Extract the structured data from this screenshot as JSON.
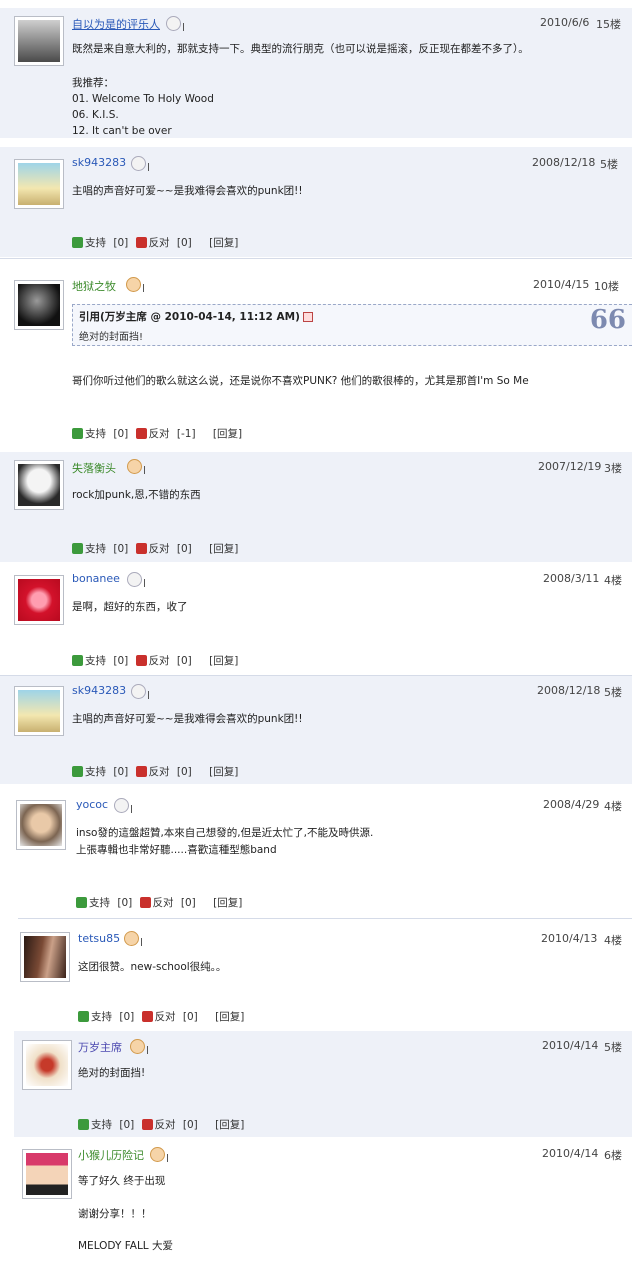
{
  "posts": [
    {
      "user": "自以为是的评乐人",
      "date": "2010/6/6",
      "floor": "15楼",
      "lines": [
        "既然是来自意大利的，那就支持一下。典型的流行朋克（也可以说是摇滚，反正现在都差不多了）。",
        "",
        "我推荐：",
        "01. Welcome To Holy Wood",
        "06. K.I.S.",
        "12. It can't be over"
      ]
    },
    {
      "user": "sk943283",
      "date": "2008/12/18",
      "floor": "5楼",
      "lines": [
        "主唱的声音好可爱~~是我难得会喜欢的punk团!!"
      ],
      "support": "[0]",
      "oppose": "[0]"
    },
    {
      "user": "地狱之牧",
      "date": "2010/4/15",
      "floor": "10楼",
      "quote_title": "引用(万岁主席 @ 2010-04-14, 11:12 AM)",
      "quote_body": "绝对的封面挡!",
      "quote_mark": "66",
      "lines": [
        "哥们你听过他们的歌么就这么说，还是说你不喜欢PUNK? 他们的歌很棒的，尤其是那首I'm So Me"
      ],
      "support": "[0]",
      "oppose": "[-1]"
    },
    {
      "user": "失落衡头",
      "date": "2007/12/19",
      "floor": "3楼",
      "lines": [
        "rock加punk,恩,不错的东西"
      ],
      "support": "[0]",
      "oppose": "[0]"
    },
    {
      "user": "bonanee",
      "date": "2008/3/11",
      "floor": "4楼",
      "lines": [
        "是啊，超好的东西，收了"
      ],
      "support": "[0]",
      "oppose": "[0]"
    },
    {
      "user": "sk943283",
      "date": "2008/12/18",
      "floor": "5楼",
      "lines": [
        "主唱的声音好可爱~~是我难得会喜欢的punk团!!"
      ],
      "support": "[0]",
      "oppose": "[0]"
    },
    {
      "user": "yococ",
      "date": "2008/4/29",
      "floor": "4楼",
      "lines": [
        "inso發的這盤超贊,本來自己想發的,但是近太忙了,不能及時供源.",
        "上張專輯也非常好聽.....喜歡這種型態band"
      ],
      "support": "[0]",
      "oppose": "[0]"
    },
    {
      "user": "tetsu85",
      "date": "2010/4/13",
      "floor": "4楼",
      "lines": [
        "这团很赞。new-school很纯。。"
      ],
      "support": "[0]",
      "oppose": "[0]"
    },
    {
      "user": "万岁主席",
      "date": "2010/4/14",
      "floor": "5楼",
      "lines": [
        "绝对的封面挡!"
      ],
      "support": "[0]",
      "oppose": "[0]"
    },
    {
      "user": "小猴儿历险记",
      "date": "2010/4/14",
      "floor": "6楼",
      "lines": [
        "等了好久 终于出现",
        "",
        "谢谢分享！！！",
        "",
        "MELODY FALL 大爱"
      ]
    }
  ],
  "labels": {
    "support": "支持",
    "oppose": "反对",
    "reply": "[回复]"
  },
  "colors": {
    "row_alt": "#eef1f8",
    "username_blue": "#2a59b8",
    "username_green": "#3b8a2a",
    "support": "#3c9a3c",
    "oppose": "#c9302c"
  }
}
